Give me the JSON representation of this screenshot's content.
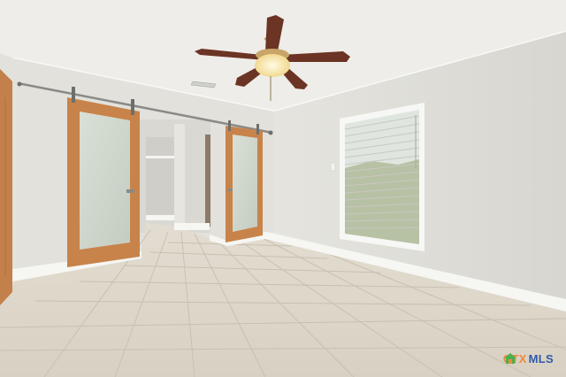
{
  "image": {
    "subject": "empty-bedroom-interior",
    "watermark": {
      "prefix": "CTX",
      "suffix": "MLS",
      "colors": {
        "prefix": "#f08a3c",
        "suffix": "#2f5aa8",
        "icon": "#4caf50"
      }
    }
  },
  "palette": {
    "ceiling": "#eeede8",
    "left_wall": "#e3e2dc",
    "right_wall": "#e7e6e1",
    "back_wall": "#e1e0da",
    "floor": "#dcd6ca",
    "grout": "#c9c2b4",
    "door_frame": "#c9854a",
    "door_glass": "#cfd6cc",
    "baseboard": "#f6f6f3",
    "window_blind": "#f2f2f0",
    "fan_blade": "#6b3424",
    "fan_light": "#f4e2a8"
  }
}
